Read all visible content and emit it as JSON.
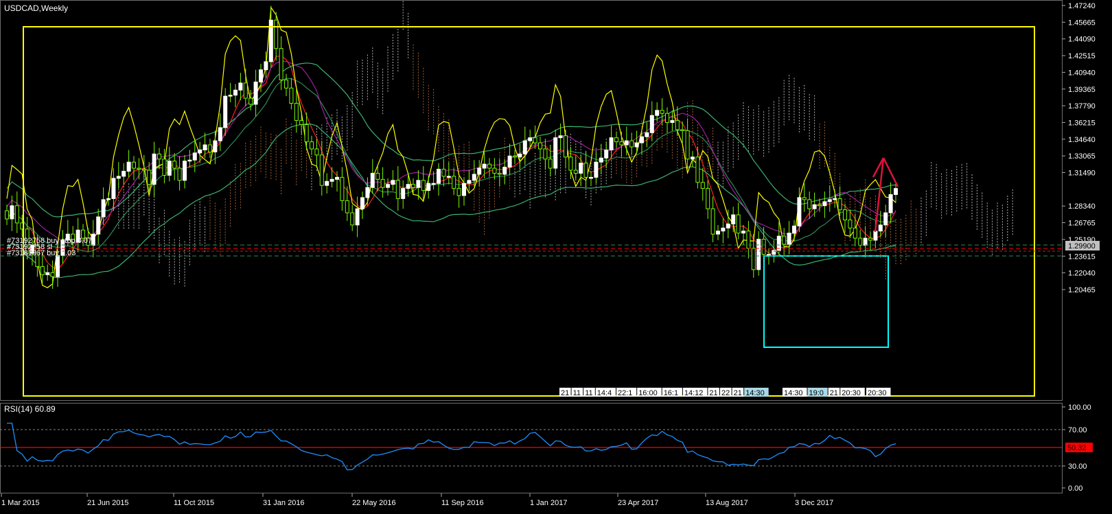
{
  "window": {
    "symbol_title": "USDCAD,Weekly"
  },
  "price_axis": {
    "labels": [
      "1.47240",
      "1.45665",
      "1.44090",
      "1.42515",
      "1.40940",
      "1.39365",
      "1.37790",
      "1.36215",
      "1.34640",
      "1.33065",
      "1.31490",
      "1.28340",
      "1.26765",
      "1.25190",
      "1.23615",
      "1.22040",
      "1.20465"
    ],
    "current_price": "1.29900"
  },
  "orders": [
    {
      "text": "#73192758 buy stop 0.07"
    },
    {
      "text": "#73192758 sl"
    },
    {
      "text": "#73181967 buy 0.03"
    }
  ],
  "time_axis": {
    "labels": [
      "1 Mar 2015",
      "21 Jun 2015",
      "11 Oct 2015",
      "31 Jan 2016",
      "22 May 2016",
      "11 Sep 2016",
      "1 Jan 2017",
      "23 Apr 2017",
      "13 Aug 2017",
      "3 Dec 2017"
    ]
  },
  "time_chips": [
    {
      "text": "21",
      "color": "#ffffff"
    },
    {
      "text": "11",
      "color": "#ffffff"
    },
    {
      "text": "11",
      "color": "#ffffff"
    },
    {
      "text": "14:4",
      "color": "#ffffff"
    },
    {
      "text": "22:1",
      "color": "#ffffff"
    },
    {
      "text": "16:00",
      "color": "#ffffff"
    },
    {
      "text": "16:1",
      "color": "#ffffff"
    },
    {
      "text": "14:12",
      "color": "#ffffff"
    },
    {
      "text": "21",
      "color": "#ffffff"
    },
    {
      "text": "22",
      "color": "#ffffff"
    },
    {
      "text": "21",
      "color": "#ffffff"
    },
    {
      "text": "14:30",
      "color": "#a9d8e6"
    },
    {
      "text": "14:30",
      "color": "#ffffff"
    },
    {
      "text": "19:0",
      "color": "#a9d8e6"
    },
    {
      "text": "21",
      "color": "#ffffff"
    },
    {
      "text": "20:30",
      "color": "#ffffff"
    },
    {
      "text": "20:30",
      "color": "#ffffff"
    }
  ],
  "rsi": {
    "title": "RSI(14) 60.89",
    "levels": [
      "100.00",
      "70.00",
      "30.00",
      "0.00"
    ],
    "current_value": "50.32"
  },
  "colors": {
    "background": "#000000",
    "grid_text": "#ffffff",
    "bull_candle": "#ffffff",
    "bear_candle": "#7cfc00",
    "rect_yellow": "#ffff00",
    "rect_cyan": "#00ffff",
    "arrow": "#dc143c",
    "rsi_line": "#1e90ff",
    "rsi_mid_line": "#ff0000",
    "current_price_tag": "#c0c0c0"
  },
  "chart_data": {
    "type": "candlestick",
    "title": "USDCAD,Weekly",
    "ylim": [
      1.19,
      1.4724
    ],
    "close_values": [
      1.262,
      1.275,
      1.258,
      1.252,
      1.228,
      1.236,
      1.215,
      1.207,
      1.209,
      1.205,
      1.226,
      1.241,
      1.247,
      1.239,
      1.251,
      1.243,
      1.236,
      1.247,
      1.264,
      1.281,
      1.282,
      1.302,
      1.304,
      1.309,
      1.318,
      1.312,
      1.311,
      1.31,
      1.296,
      1.326,
      1.321,
      1.305,
      1.319,
      1.312,
      1.3,
      1.319,
      1.32,
      1.327,
      1.33,
      1.335,
      1.328,
      1.339,
      1.352,
      1.383,
      1.384,
      1.389,
      1.396,
      1.381,
      1.375,
      1.397,
      1.409,
      1.417,
      1.458,
      1.43,
      1.399,
      1.391,
      1.376,
      1.359,
      1.355,
      1.338,
      1.331,
      1.325,
      1.295,
      1.299,
      1.301,
      1.303,
      1.28,
      1.268,
      1.256,
      1.272,
      1.283,
      1.293,
      1.307,
      1.301,
      1.293,
      1.296,
      1.3,
      1.282,
      1.292,
      1.296,
      1.293,
      1.3,
      1.29,
      1.297,
      1.297,
      1.311,
      1.304,
      1.304,
      1.292,
      1.285,
      1.297,
      1.3,
      1.306,
      1.312,
      1.316,
      1.312,
      1.307,
      1.306,
      1.313,
      1.324,
      1.323,
      1.326,
      1.339,
      1.342,
      1.337,
      1.331,
      1.321,
      1.312,
      1.342,
      1.344,
      1.323,
      1.31,
      1.307,
      1.317,
      1.303,
      1.303,
      1.318,
      1.322,
      1.33,
      1.342,
      1.338,
      1.335,
      1.339,
      1.333,
      1.337,
      1.343,
      1.347,
      1.364,
      1.369,
      1.366,
      1.357,
      1.359,
      1.35,
      1.349,
      1.321,
      1.323,
      1.298,
      1.292,
      1.272,
      1.247,
      1.25,
      1.253,
      1.257,
      1.266,
      1.248,
      1.25,
      1.233,
      1.212,
      1.242,
      1.227,
      1.227,
      1.231,
      1.245,
      1.237,
      1.248,
      1.255,
      1.283,
      1.281,
      1.272,
      1.276,
      1.275,
      1.279,
      1.281,
      1.282,
      1.271,
      1.261,
      1.253,
      1.243,
      1.236,
      1.243,
      1.241,
      1.25,
      1.256,
      1.268,
      1.286,
      1.292
    ],
    "indicators": [
      "Ichimoku cloud",
      "Bollinger Bands",
      "Moving averages",
      "Yellow oscillator"
    ],
    "rsi_last": 60.89
  }
}
